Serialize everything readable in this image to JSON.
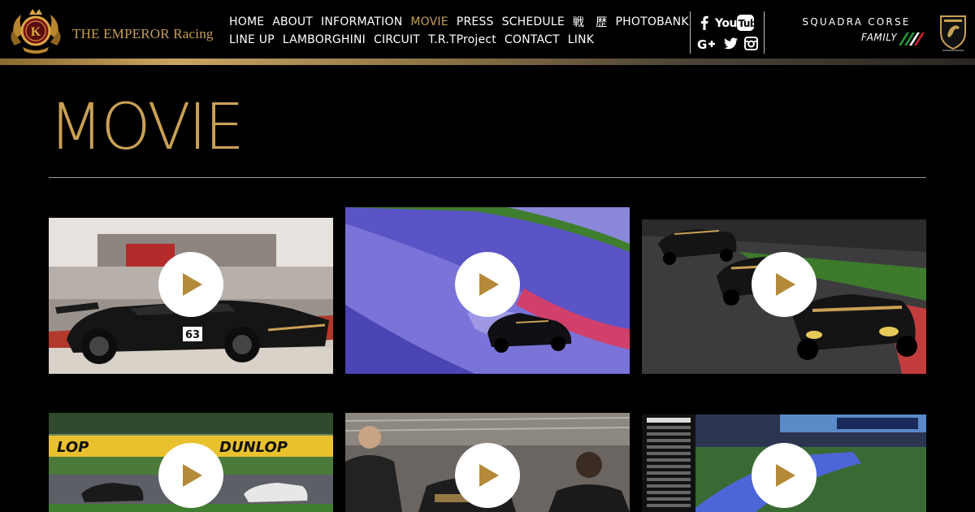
{
  "brand": {
    "name": "THE EMPEROR Racing"
  },
  "nav": {
    "row1": [
      {
        "label": "HOME"
      },
      {
        "label": "ABOUT"
      },
      {
        "label": "INFORMATION"
      },
      {
        "label": "MOVIE",
        "active": true
      },
      {
        "label": "PRESS"
      },
      {
        "label": "SCHEDULE"
      },
      {
        "label": "戦　歴"
      },
      {
        "label": "PHOTOBANK"
      }
    ],
    "row2": [
      {
        "label": "LINE UP"
      },
      {
        "label": "LAMBORGHINI"
      },
      {
        "label": "CIRCUIT"
      },
      {
        "label": "T.R.TProject"
      },
      {
        "label": "CONTACT"
      },
      {
        "label": "LINK"
      }
    ]
  },
  "social": {
    "icons": [
      "facebook-icon",
      "youtube-icon",
      "google-plus-icon",
      "twitter-icon",
      "instagram-icon"
    ],
    "youtube_label": "YouTube"
  },
  "partner": {
    "squadra_corse": "SQUADRA CORSE",
    "family": "FAMILY"
  },
  "page": {
    "title": "MOVIE"
  },
  "videos": [
    {
      "scene": "black-lamborghini-63-on-track"
    },
    {
      "scene": "car-spinning-on-wet-track"
    },
    {
      "scene": "three-cars-racing"
    },
    {
      "scene": "dunlop-bridge-corner"
    },
    {
      "scene": "pit-crew-team"
    },
    {
      "scene": "race-broadcast-leaderboard"
    }
  ],
  "colors": {
    "accent_gold": "#c9a055",
    "background": "#000000",
    "text": "#ffffff"
  }
}
